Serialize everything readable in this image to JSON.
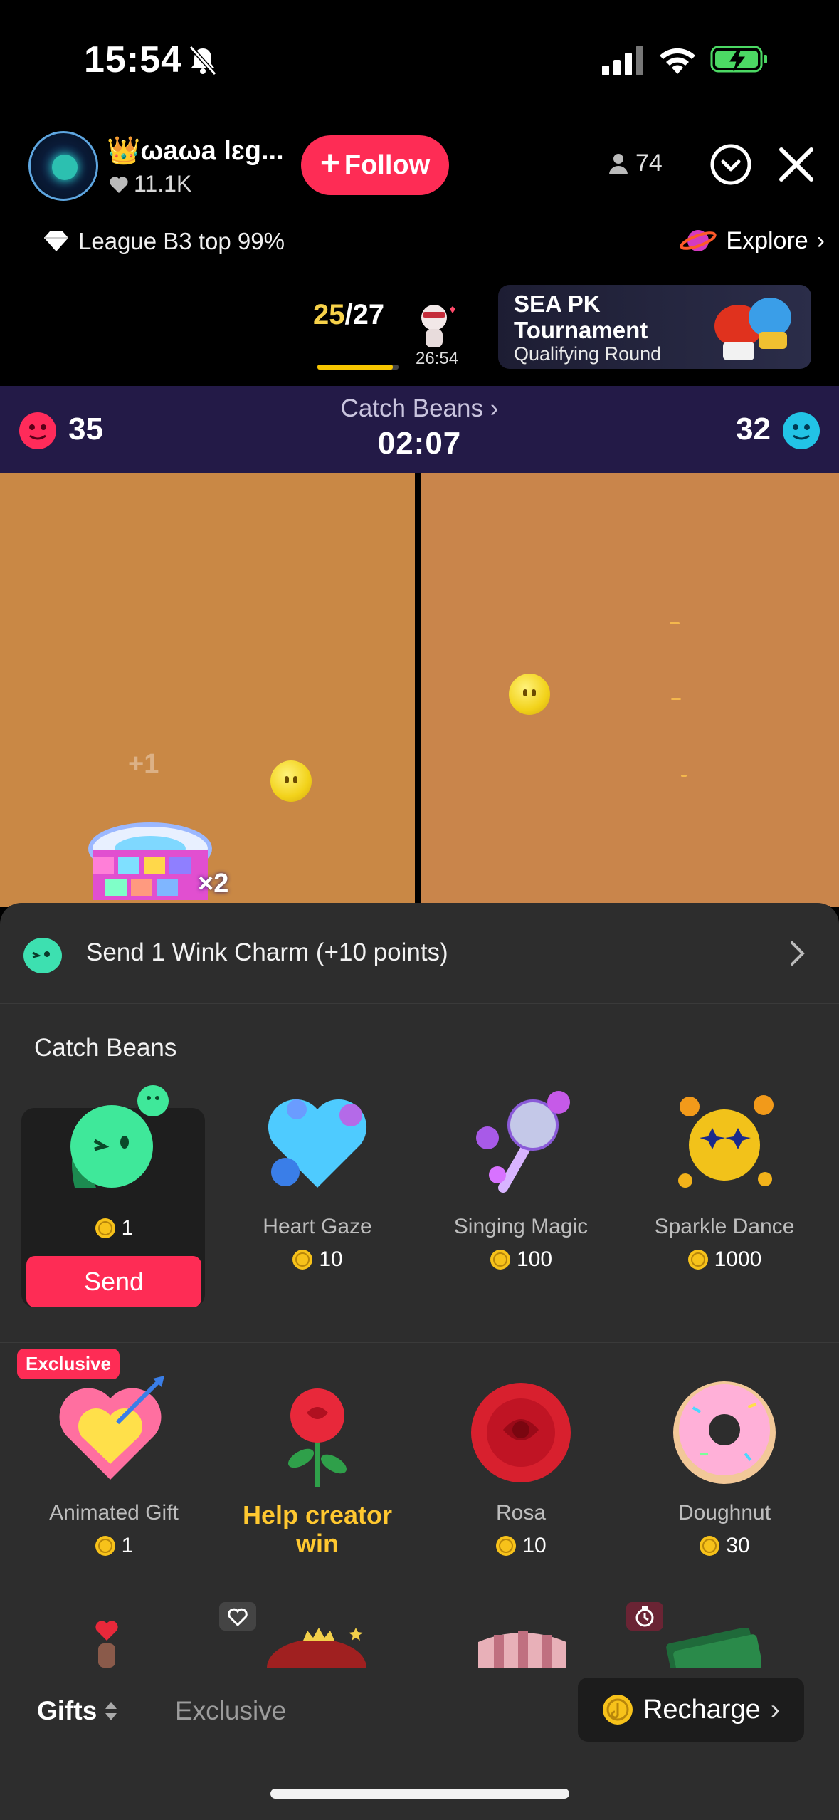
{
  "status_bar": {
    "time": "15:54"
  },
  "header": {
    "creator_name": "👑ωаωа lɛg...",
    "likes": "11.1K",
    "follow_label": "Follow",
    "viewer_count": "74"
  },
  "league": {
    "label": "League B3 top 99%"
  },
  "explore": {
    "label": "Explore"
  },
  "rank": {
    "current": "25",
    "total": "/27",
    "timer": "26:54",
    "progress": 0.93
  },
  "tournament": {
    "title": "SEA PK Tournament",
    "subtitle": "Qualifying Round"
  },
  "pk": {
    "left_score": "35",
    "right_score": "32",
    "mode": "Catch Beans",
    "timer": "02:07"
  },
  "game": {
    "plus_label": "+1",
    "multiplier": "×2"
  },
  "promo": {
    "text": "Send 1 Wink Charm (+10 points)"
  },
  "gift_section": {
    "title": "Catch Beans"
  },
  "gifts_row1": [
    {
      "name": "",
      "price": "1",
      "send_label": "Send"
    },
    {
      "name": "Heart Gaze",
      "price": "10"
    },
    {
      "name": "Singing Magic",
      "price": "100"
    },
    {
      "name": "Sparkle Dance",
      "price": "1000"
    }
  ],
  "gifts_row2": [
    {
      "name": "Animated Gift",
      "price": "1",
      "badge": "Exclusive"
    },
    {
      "name": "Help creator win"
    },
    {
      "name": "Rosa",
      "price": "10"
    },
    {
      "name": "Doughnut",
      "price": "30"
    }
  ],
  "tabs": {
    "gifts": "Gifts",
    "exclusive": "Exclusive"
  },
  "recharge": {
    "label": "Recharge"
  },
  "colors": {
    "accent": "#fe2c55",
    "pk_bar": "#231a47",
    "game_bg": "#c98845",
    "panel": "#2d2d2d",
    "gold": "#ffc830"
  }
}
